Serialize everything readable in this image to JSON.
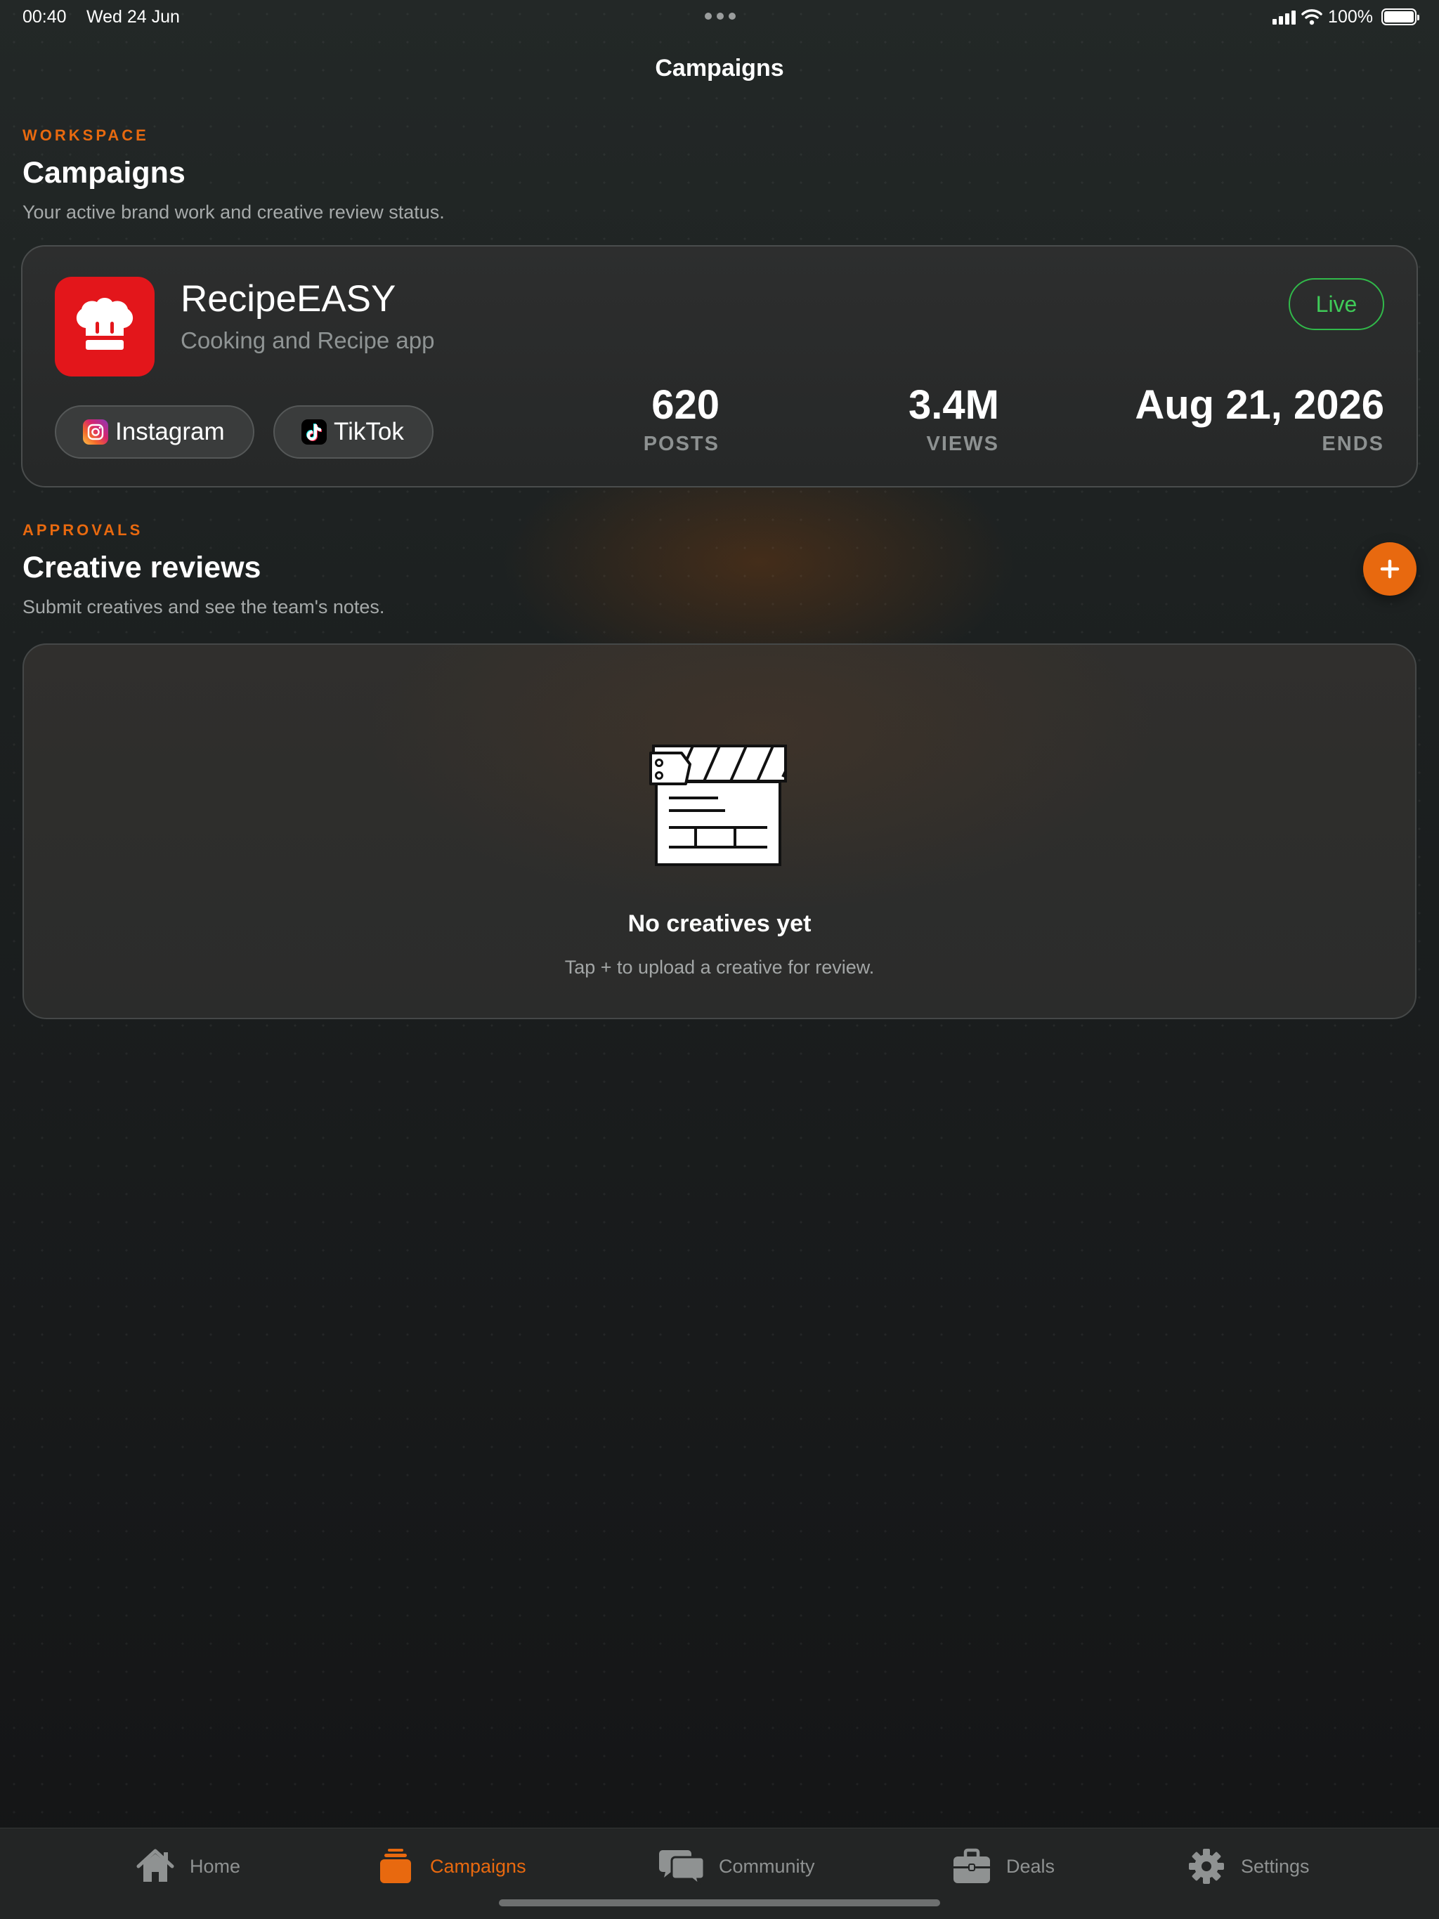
{
  "status_bar": {
    "time": "00:40",
    "date": "Wed 24 Jun",
    "battery": "100%"
  },
  "nav": {
    "title": "Campaigns"
  },
  "workspace": {
    "eyebrow": "WORKSPACE",
    "title": "Campaigns",
    "subtitle": "Your active brand work and creative review status."
  },
  "campaign": {
    "icon": "chef-hat-icon",
    "name": "RecipeEASY",
    "tagline": "Cooking and Recipe app",
    "status": "Live",
    "platforms": [
      {
        "label": "Instagram",
        "icon": "instagram-icon"
      },
      {
        "label": "TikTok",
        "icon": "tiktok-icon"
      }
    ],
    "stats": [
      {
        "value": "620",
        "label": "POSTS"
      },
      {
        "value": "3.4M",
        "label": "VIEWS"
      },
      {
        "value": "Aug 21, 2026",
        "label": "ENDS"
      }
    ]
  },
  "approvals": {
    "eyebrow": "APPROVALS",
    "title": "Creative reviews",
    "subtitle": "Submit creatives and see the team's notes.",
    "add_icon": "plus-icon"
  },
  "empty_state": {
    "icon": "clapperboard-icon",
    "title": "No creatives yet",
    "subtitle": "Tap + to upload a creative for review."
  },
  "tabs": [
    {
      "label": "Home",
      "icon": "home-icon",
      "active": false
    },
    {
      "label": "Campaigns",
      "icon": "stack-icon",
      "active": true
    },
    {
      "label": "Community",
      "icon": "chat-bubbles-icon",
      "active": false
    },
    {
      "label": "Deals",
      "icon": "briefcase-icon",
      "active": false
    },
    {
      "label": "Settings",
      "icon": "gear-icon",
      "active": false
    }
  ],
  "colors": {
    "accent": "#e8690f",
    "live": "#3fcb58",
    "brand_red": "#e3161b",
    "background": "#1c1f1f"
  }
}
